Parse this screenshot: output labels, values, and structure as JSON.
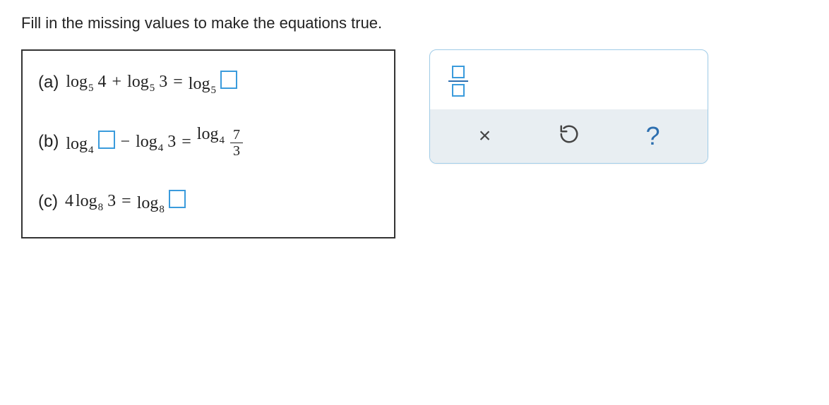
{
  "instructions": "Fill in the missing values to make the equations true.",
  "problems": {
    "a": {
      "label": "(a)",
      "t1_log": "log",
      "t1_base": "5",
      "t1_arg": "4",
      "op1": "+",
      "t2_log": "log",
      "t2_base": "5",
      "t2_arg": "3",
      "eq": "=",
      "t3_log": "log",
      "t3_base": "5"
    },
    "b": {
      "label": "(b)",
      "t1_log": "log",
      "t1_base": "4",
      "op1": "−",
      "t2_log": "log",
      "t2_base": "4",
      "t2_arg": "3",
      "eq": "=",
      "t3_log": "log",
      "t3_base": "4",
      "frac_num": "7",
      "frac_den": "3"
    },
    "c": {
      "label": "(c)",
      "coef": "4",
      "t1_log": "log",
      "t1_base": "8",
      "t1_arg": "3",
      "eq": "=",
      "t2_log": "log",
      "t2_base": "8"
    }
  },
  "palette": {
    "fraction_tool": "fraction-input"
  },
  "actions": {
    "clear": "×",
    "reset": "↺",
    "help": "?"
  },
  "chart_data": {
    "type": "table",
    "title": "Logarithm equations to complete",
    "equations": [
      {
        "id": "a",
        "expression": "log_5 4 + log_5 3 = log_5 □",
        "unknown_side": "right",
        "bases": [
          5,
          5,
          5
        ]
      },
      {
        "id": "b",
        "expression": "log_4 □ − log_4 3 = log_4 (7/3)",
        "unknown_side": "left",
        "bases": [
          4,
          4,
          4
        ],
        "rhs_fraction": {
          "num": 7,
          "den": 3
        }
      },
      {
        "id": "c",
        "expression": "4 log_8 3 = log_8 □",
        "unknown_side": "right",
        "bases": [
          8,
          8
        ],
        "coefficient": 4
      }
    ]
  }
}
